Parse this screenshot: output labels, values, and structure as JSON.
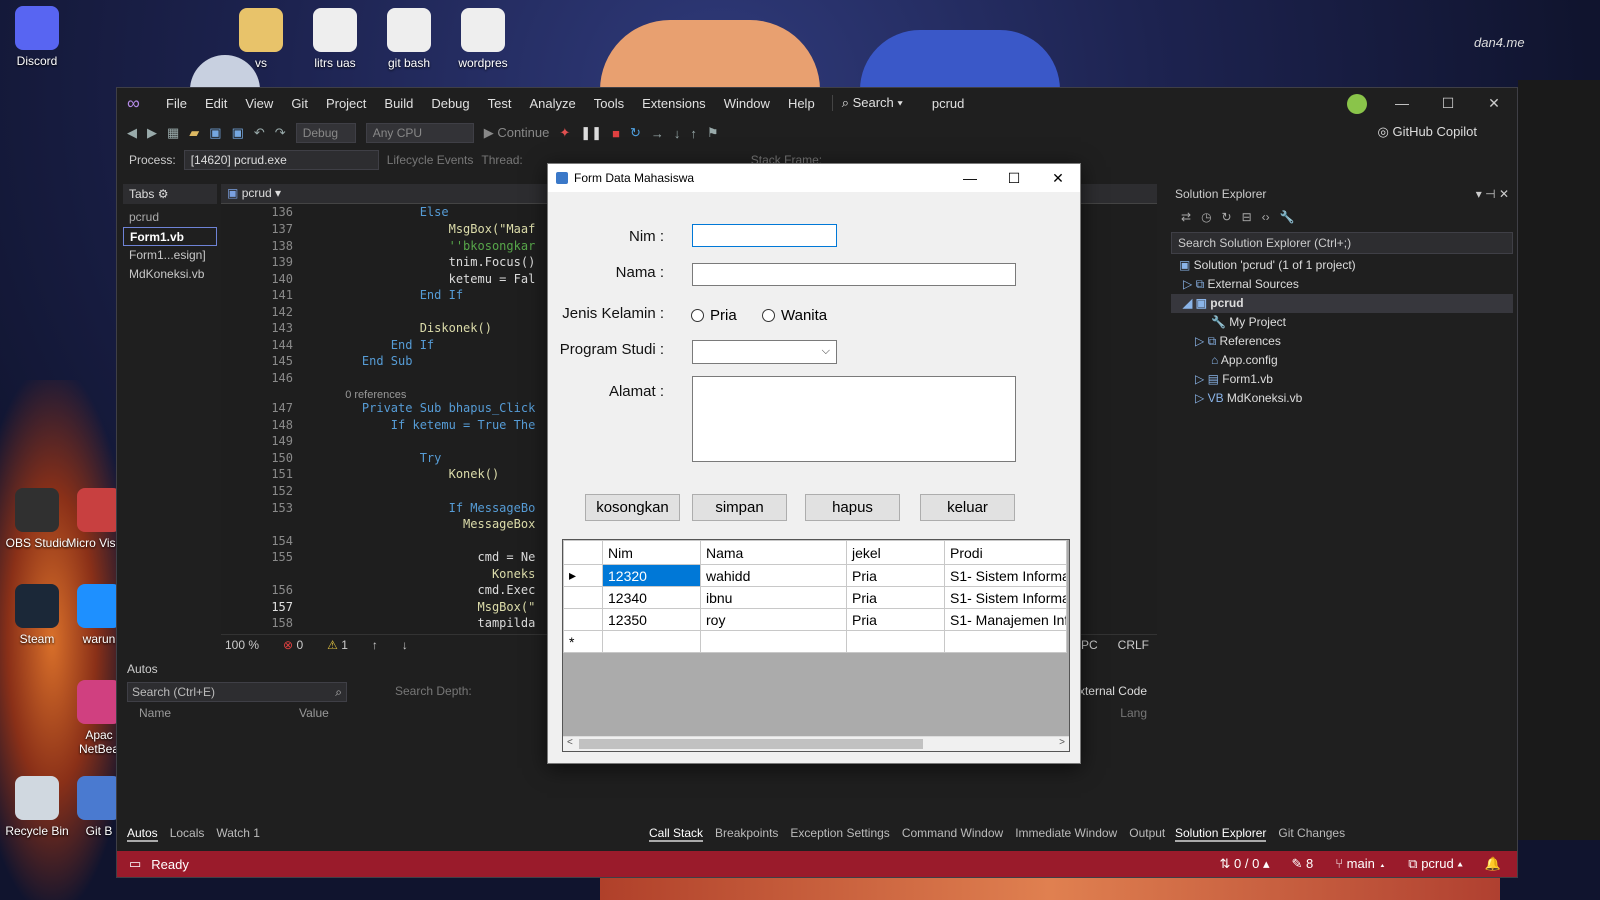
{
  "desktop": {
    "icons": [
      {
        "label": "Discord",
        "color": "#5865f2"
      },
      {
        "label": "vs",
        "color": "#e8c36a"
      },
      {
        "label": "litrs uas",
        "color": "#eeeeee"
      },
      {
        "label": "git bash",
        "color": "#eeeeee"
      },
      {
        "label": "wordpres",
        "color": "#eeeeee"
      },
      {
        "label": "OBS Studio",
        "color": "#303030"
      },
      {
        "label": "Micro Visual",
        "color": "#c84040"
      },
      {
        "label": "Steam",
        "color": "#1b2838"
      },
      {
        "label": "warun",
        "color": "#1e90ff"
      },
      {
        "label": "Apac NetBea",
        "color": "#d04080"
      },
      {
        "label": "Recycle Bin",
        "color": "#d0d8e0"
      },
      {
        "label": "Git B",
        "color": "#4a7ad0"
      }
    ],
    "watermark": "dan4.me"
  },
  "vs": {
    "menu": [
      "File",
      "Edit",
      "View",
      "Git",
      "Project",
      "Build",
      "Debug",
      "Test",
      "Analyze",
      "Tools",
      "Extensions",
      "Window",
      "Help"
    ],
    "search_label": "Search",
    "solution_title": "pcrud",
    "toolbar": {
      "config": "Debug",
      "platform": "Any CPU",
      "continue_label": "Continue",
      "copilot_label": "GitHub Copilot"
    },
    "process": {
      "label": "Process:",
      "value": "[14620] pcrud.exe",
      "lifecycle": "Lifecycle Events",
      "thread": "Thread:",
      "stack": "Stack Frame:"
    },
    "tabs_title": "Tabs",
    "tablist": {
      "project": "pcrud",
      "items": [
        "Form1.vb",
        "Form1...esign]",
        "MdKoneksi.vb"
      ]
    },
    "editor": {
      "dropdown": "pcrud",
      "lines": [
        {
          "n": "136",
          "code": "            Else"
        },
        {
          "n": "137",
          "code": "                MsgBox(\"Maaf"
        },
        {
          "n": "138",
          "code": "                ''bkosongkar"
        },
        {
          "n": "139",
          "code": "                tnim.Focus()"
        },
        {
          "n": "140",
          "code": "                ketemu = Fal"
        },
        {
          "n": "141",
          "code": "            End If"
        },
        {
          "n": "142",
          "code": ""
        },
        {
          "n": "143",
          "code": "            Diskonek()"
        },
        {
          "n": "144",
          "code": "        End If"
        },
        {
          "n": "145",
          "code": "    End Sub"
        },
        {
          "n": "146",
          "code": ""
        },
        {
          "n": "",
          "code": "    0 references"
        },
        {
          "n": "147",
          "code": "    Private Sub bhapus_Click"
        },
        {
          "n": "148",
          "code": "        If ketemu = True The"
        },
        {
          "n": "149",
          "code": ""
        },
        {
          "n": "150",
          "code": "            Try"
        },
        {
          "n": "151",
          "code": "                Konek()"
        },
        {
          "n": "152",
          "code": ""
        },
        {
          "n": "153",
          "code": "                If MessageBo"
        },
        {
          "n": "",
          "code": "                  MessageBox"
        },
        {
          "n": "154",
          "code": ""
        },
        {
          "n": "155",
          "code": "                    cmd = Ne"
        },
        {
          "n": "",
          "code": "                      Koneks"
        },
        {
          "n": "156",
          "code": "                    cmd.Exec"
        },
        {
          "n": "157",
          "code": "                    MsgBox(\""
        },
        {
          "n": "158",
          "code": "                    tampilda"
        }
      ],
      "zoom": "100 %",
      "errors": "0",
      "warnings": "1",
      "spc": "SPC",
      "crlf": "CRLF"
    },
    "autos": {
      "title": "Autos",
      "search": "Search (Ctrl+E)",
      "depth": "Search Depth:",
      "col_name": "Name",
      "col_value": "Value",
      "tabs": [
        "Autos",
        "Locals",
        "Watch 1"
      ]
    },
    "callstack": {
      "external": "External Code",
      "lang": "Lang",
      "tabs": [
        "Call Stack",
        "Breakpoints",
        "Exception Settings",
        "Command Window",
        "Immediate Window",
        "Output"
      ]
    },
    "solution_explorer": {
      "title": "Solution Explorer",
      "search": "Search Solution Explorer (Ctrl+;)",
      "items": [
        "Solution 'pcrud' (1 of 1 project)",
        "External Sources",
        "pcrud",
        "My Project",
        "References",
        "App.config",
        "Form1.vb",
        "MdKoneksi.vb"
      ],
      "tabs": [
        "Solution Explorer",
        "Git Changes"
      ]
    },
    "status": {
      "ready": "Ready",
      "git": "0 / 0",
      "edits": "8",
      "branch": "main",
      "repo": "pcrud"
    }
  },
  "form": {
    "title": "Form Data Mahasiswa",
    "labels": {
      "nim": "Nim :",
      "nama": "Nama :",
      "jk": "Jenis Kelamin :",
      "prodi": "Program Studi :",
      "alamat": "Alamat  :"
    },
    "radios": {
      "pria": "Pria",
      "wanita": "Wanita"
    },
    "buttons": {
      "kosongkan": "kosongkan",
      "simpan": "simpan",
      "hapus": "hapus",
      "keluar": "keluar"
    },
    "grid": {
      "columns": [
        "Nim",
        "Nama",
        "jekel",
        "Prodi"
      ],
      "rows": [
        [
          "12320",
          "wahidd",
          "Pria",
          "S1- Sistem Informa"
        ],
        [
          "12340",
          "ibnu",
          "Pria",
          "S1- Sistem Informa"
        ],
        [
          "12350",
          "roy",
          "Pria",
          "S1- Manajemen Inf"
        ]
      ],
      "new_row_marker": "*"
    }
  }
}
